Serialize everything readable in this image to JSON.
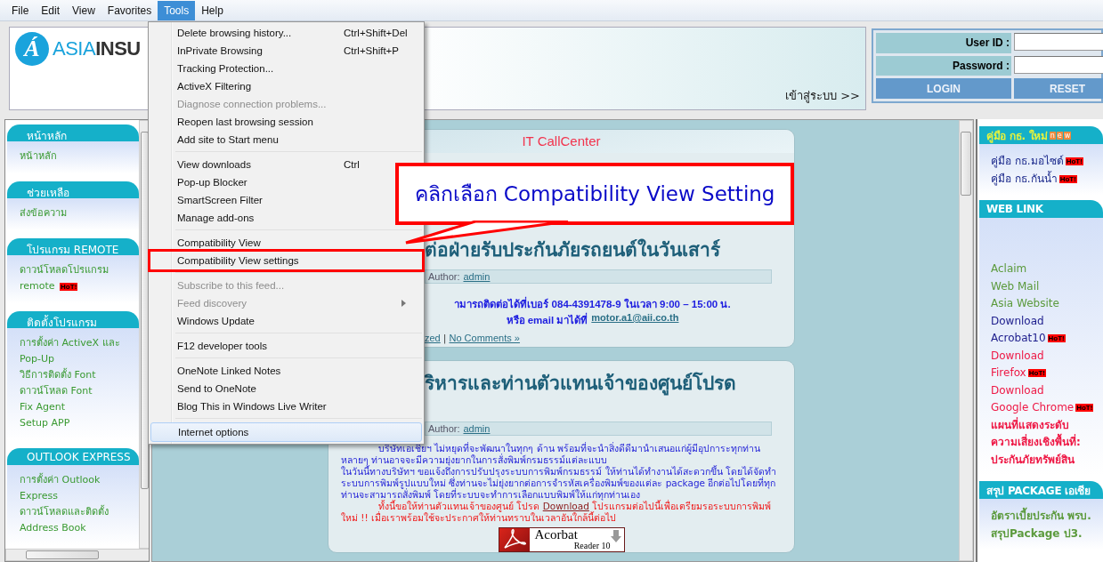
{
  "menubar": [
    {
      "label": "File",
      "selected": false
    },
    {
      "label": "Edit",
      "selected": false
    },
    {
      "label": "View",
      "selected": false
    },
    {
      "label": "Favorites",
      "selected": false
    },
    {
      "label": "Tools",
      "selected": true
    },
    {
      "label": "Help",
      "selected": false
    }
  ],
  "header": {
    "logo": {
      "mark": "Á",
      "name": "ASIA**INSU**"
    },
    "login_link": "เข้าสู่ระบบ >>"
  },
  "login": {
    "fields": [
      {
        "label": "User ID :"
      },
      {
        "label": "Password :"
      }
    ],
    "buttons": [
      "LOGIN",
      "RESET"
    ]
  },
  "left_sidebar": {
    "sections": [
      {
        "heading": "หน้าหลัก",
        "items": [
          {
            "text": "หน้าหลัก"
          }
        ]
      },
      {
        "heading": "ช่วยเหลือ",
        "items": [
          {
            "text": "ส่งข้อความ"
          }
        ]
      },
      {
        "heading": "โปรแกรม REMOTE",
        "items": [
          {
            "text": "ดาวน์โหลดโปรแกรม"
          },
          {
            "text": "remote",
            "badge": "HoT!"
          }
        ]
      },
      {
        "heading": "ติดตั้งโปรแกรม",
        "items": [
          {
            "text": "การตั้งค่า ActiveX และ"
          },
          {
            "text": "Pop-Up"
          },
          {
            "text": "วิธีการติดตั้ง Font"
          },
          {
            "text": "ดาวน์โหลด Font"
          },
          {
            "text": "Fix Agent"
          },
          {
            "text": "Setup APP"
          }
        ]
      },
      {
        "heading": "OUTLOOK EXPRESS",
        "items": [
          {
            "text": "การตั้งค่า Outlook"
          },
          {
            "text": "Express"
          },
          {
            "text": "ดาวน์โหลดและติดตั้ง"
          },
          {
            "text": "Address Book"
          }
        ]
      }
    ]
  },
  "callcenter_card": {
    "title": "IT CallCenter",
    "headline": "ต่อฝ่ายรับประกันภัยรถยนต์ในวันเสาร์",
    "author_label": "Author:",
    "author": "admin",
    "contact_line": "ามารถติดต่อได้ที่เบอร์ 084-4391478-9 ในเวลา 9:00 – 15:00 น.",
    "email_line": {
      "text": "หรือ email มาได้ที่",
      "link": "motor.a1@aii.co.th"
    },
    "footer": {
      "category": "zed",
      "separator": "|",
      "comments": "No Comments »"
    }
  },
  "news_card": {
    "headline": "ริหารและท่านตัวแทนเจ้าของศูนย์โปรด",
    "author_label": "Author:",
    "author": "admin",
    "paragraphs": [
      "บริษัทเอเชียฯ ไม่หยุดที่จะพัฒนาในทุกๆ ด้าน พร้อมที่จะนำสิ่งดีดีมานำเสนอแก่ผู้มีอุปการะทุกท่านหลายๆ ท่านอาจจะมีความยุ่งยากในการสั่งพิมพ์กรมธรรม์แต่ละแบบ",
      "ในวันนี้ทางบริษัทฯ ขอแจ้งถึงการปรับปรุงระบบการพิมพ์กรมธรรม์ ให้ท่านได้ทำงานได้สะดวกขึ้น โดยได้จัดทำระบบการพิมพ์รูปแบบใหม่ ซึ่งท่านจะไม่ยุ่งยากต่อการจำรหัสเครื่องพิมพ์ของแต่ละ package อีกต่อไปโดยที่ทุกท่านจะสามารถสั่งพิมพ์ โดยที่ระบบจะทำการเลือกแบบพิมพ์ให้แก่ทุกท่านเอง"
    ],
    "notice": {
      "before": "ทั้งนี้ขอให้ท่านตัวแทนเจ้าของศูนย์ โปรด",
      "link": "Download",
      "after": "โปรแกรมต่อไปนี้เพื่อเตรียมรอระบบการพิมพ์ใหม่ !! เมื่อเราพร้อมใช้จะประกาศให้ท่านทราบในเวลาอันใกล้นี้ต่อไป"
    },
    "banner": {
      "title": "Acorbat",
      "subtitle": "Reader 10"
    }
  },
  "right_sidebar": {
    "sections": [
      {
        "heading": "คู่มือ กธ. ใหม่",
        "highlighted": true,
        "badge": [
          "n",
          "e",
          "w"
        ],
        "items": [
          {
            "text": "คู่มือ กธ.มอไซด์",
            "badge": "HoT!",
            "color": "#1c2a8c",
            "bold": false
          },
          {
            "text": "คู่มือ กธ.กันน้ำ",
            "badge": "HoT!",
            "color": "#1c2a8c",
            "bold": false
          }
        ]
      },
      {
        "heading": "WEB LINK",
        "highlighted": false,
        "items": [
          {
            "text": "Aclaim",
            "color": "#5b9a3c",
            "bold": false
          },
          {
            "text": "Web Mail",
            "color": "#5b9a3c",
            "bold": false
          },
          {
            "text": "Asia Website",
            "color": "#5b9a3c",
            "bold": false
          },
          {
            "text": "Download",
            "color": "#1c1c8c",
            "bold": false
          },
          {
            "text": "Acrobat10",
            "badge": "HoT!",
            "color": "#1c1c8c",
            "bold": false
          },
          {
            "text": "Download",
            "color": "#ee1845",
            "bold": false
          },
          {
            "text": "Firefox",
            "badge": "HoT!",
            "color": "#ee1845",
            "bold": false
          },
          {
            "text": "Download",
            "color": "#ee1845",
            "bold": false
          },
          {
            "text": "Google Chrome",
            "badge": "HoT!",
            "color": "#ee1845",
            "bold": false
          },
          {
            "text": "แผนที่แสดงระดับ",
            "color": "#ee1845",
            "bold": true
          },
          {
            "text": "ความเสี่ยงเชิงพื้นที่:",
            "color": "#ee1845",
            "bold": true
          },
          {
            "text": "ประกันภัยทรัพย์สิน",
            "color": "#ee1845",
            "bold": true
          }
        ]
      },
      {
        "heading": "สรุป PACKAGE เอเชีย",
        "highlighted": false,
        "items": [
          {
            "text": "อัตราเบี้ยประกัน พรบ.",
            "color": "#5b9a3c",
            "bold": true
          },
          {
            "text": "สรุปPackage ป3.",
            "color": "#5b9a3c",
            "bold": true
          }
        ]
      }
    ]
  },
  "tools_menu": {
    "items": [
      {
        "kind": "item",
        "label": "Delete browsing history...",
        "shortcut": "Ctrl+Shift+Del",
        "disabled": false,
        "selected": false,
        "outlined": false
      },
      {
        "kind": "item",
        "label": "InPrivate Browsing",
        "shortcut": "Ctrl+Shift+P",
        "disabled": false,
        "selected": false,
        "outlined": false
      },
      {
        "kind": "item",
        "label": "Tracking Protection...",
        "disabled": false,
        "selected": false,
        "outlined": false
      },
      {
        "kind": "item",
        "label": "ActiveX Filtering",
        "disabled": false,
        "selected": false,
        "outlined": false
      },
      {
        "kind": "item",
        "label": "Diagnose connection problems...",
        "disabled": true,
        "selected": false,
        "outlined": false
      },
      {
        "kind": "item",
        "label": "Reopen last browsing session",
        "disabled": false,
        "selected": false,
        "outlined": false
      },
      {
        "kind": "item",
        "label": "Add site to Start menu",
        "disabled": false,
        "selected": false,
        "outlined": false
      },
      {
        "kind": "separator"
      },
      {
        "kind": "item",
        "label": "View downloads",
        "shortcut": "Ctrl",
        "disabled": false,
        "selected": false,
        "outlined": false
      },
      {
        "kind": "item",
        "label": "Pop-up Blocker",
        "disabled": false,
        "selected": false,
        "outlined": false
      },
      {
        "kind": "item",
        "label": "SmartScreen Filter",
        "disabled": false,
        "selected": false,
        "outlined": false
      },
      {
        "kind": "item",
        "label": "Manage add-ons",
        "disabled": false,
        "selected": false,
        "outlined": false
      },
      {
        "kind": "separator"
      },
      {
        "kind": "item",
        "label": "Compatibility View",
        "disabled": false,
        "selected": false,
        "outlined": false
      },
      {
        "kind": "item",
        "label": "Compatibility View settings",
        "disabled": false,
        "selected": false,
        "outlined": true
      },
      {
        "kind": "separator"
      },
      {
        "kind": "item",
        "label": "Subscribe to this feed...",
        "disabled": true,
        "selected": false,
        "outlined": false
      },
      {
        "kind": "item",
        "label": "Feed discovery",
        "disabled": true,
        "selected": false,
        "outlined": false,
        "submenu": true
      },
      {
        "kind": "item",
        "label": "Windows Update",
        "disabled": false,
        "selected": false,
        "outlined": false
      },
      {
        "kind": "separator"
      },
      {
        "kind": "item",
        "label": "F12 developer tools",
        "disabled": false,
        "selected": false,
        "outlined": false
      },
      {
        "kind": "separator"
      },
      {
        "kind": "item",
        "label": "OneNote Linked Notes",
        "disabled": false,
        "selected": false,
        "outlined": false
      },
      {
        "kind": "item",
        "label": "Send to OneNote",
        "disabled": false,
        "selected": false,
        "outlined": false
      },
      {
        "kind": "item",
        "label": "Blog This in Windows Live Writer",
        "disabled": false,
        "selected": false,
        "outlined": false
      },
      {
        "kind": "separator"
      },
      {
        "kind": "item",
        "label": "Internet options",
        "disabled": false,
        "selected": true,
        "outlined": false
      }
    ]
  },
  "annotation": {
    "text": "คลิกเลือก Compatibility View Setting"
  }
}
